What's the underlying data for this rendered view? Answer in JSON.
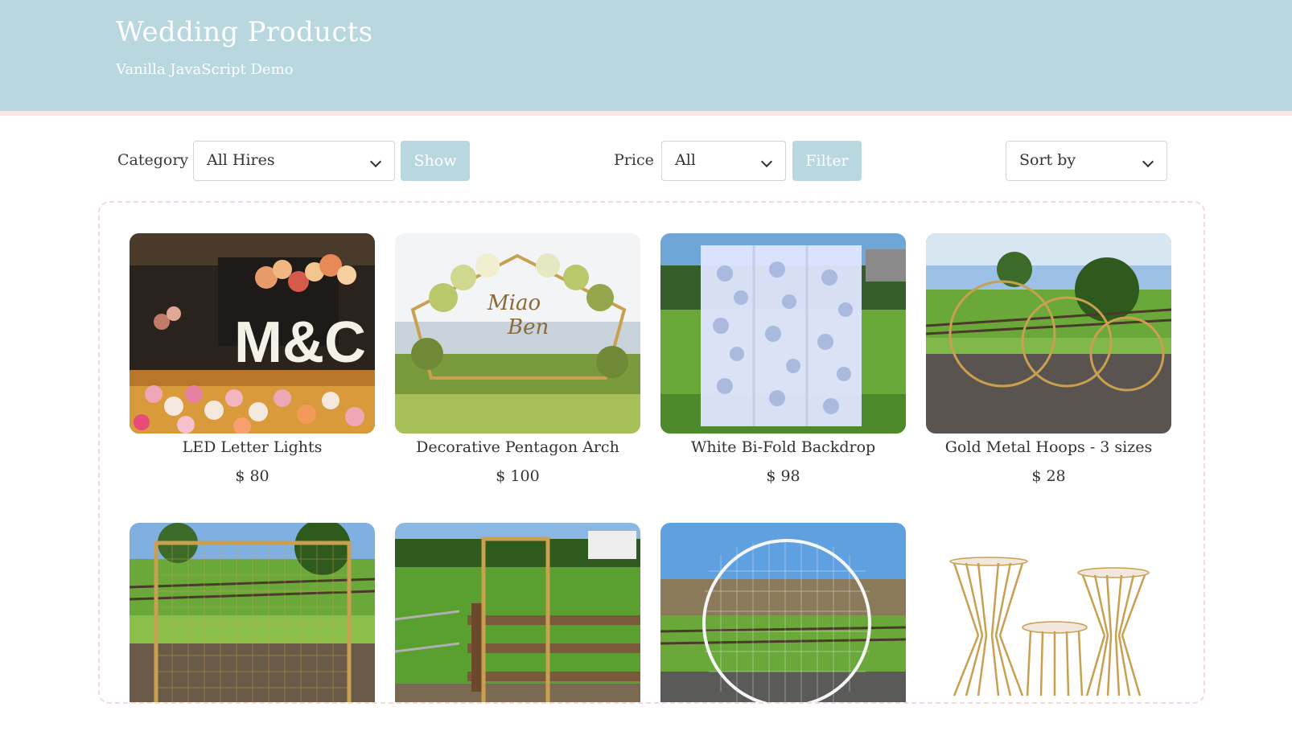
{
  "header": {
    "title": "Wedding Products",
    "subtitle": "Vanilla JavaScript Demo"
  },
  "filters": {
    "category_label": "Category",
    "category_value": "All Hires",
    "show_label": "Show",
    "price_label": "Price",
    "price_value": "All",
    "filter_label": "Filter",
    "sort_value": "Sort by"
  },
  "products": [
    {
      "name": "LED Letter Lights",
      "price": "$ 80"
    },
    {
      "name": "Decorative Pentagon Arch",
      "price": "$ 100"
    },
    {
      "name": "White Bi-Fold Backdrop",
      "price": "$ 98"
    },
    {
      "name": "Gold Metal Hoops - 3 sizes",
      "price": "$ 28"
    },
    {
      "name": "",
      "price": ""
    },
    {
      "name": "",
      "price": ""
    },
    {
      "name": "",
      "price": ""
    },
    {
      "name": "",
      "price": ""
    }
  ],
  "colors": {
    "header_bg": "#b9d7df",
    "accent_pink": "#f7d7dc",
    "button_bg": "#b9d7df"
  }
}
